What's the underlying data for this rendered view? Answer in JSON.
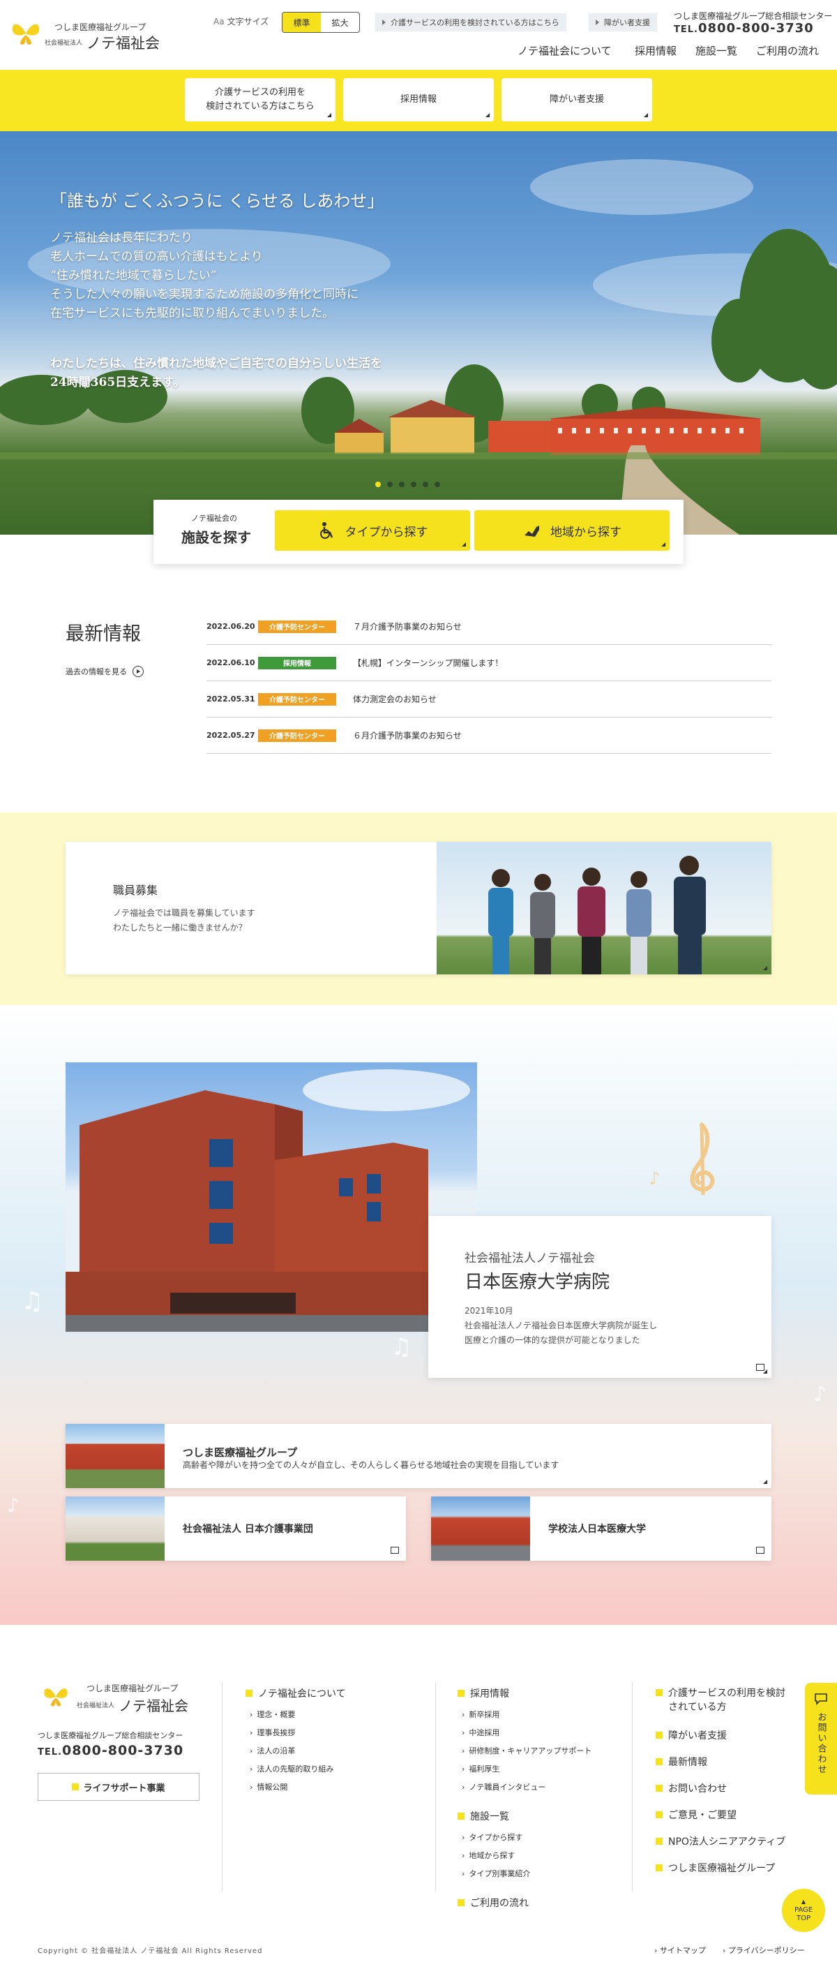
{
  "header": {
    "group_name": "つしま医療福祉グループ",
    "corp_type": "社会福祉法人",
    "org_name": "ノテ福祉会",
    "font_size_label": "文字サイズ",
    "font_size_icon": "Aa",
    "font_size_options": [
      "標準",
      "拡大"
    ],
    "utility_links": [
      "介護サービスの利用を検討されている方はこちら",
      "障がい者支援"
    ],
    "center_label": "つしま医療福祉グループ総合相談センター",
    "tel_prefix": "TEL.",
    "tel": "0800-800-3730",
    "nav": [
      "ノテ福祉会について",
      "採用情報",
      "施設一覧",
      "ご利用の流れ"
    ]
  },
  "band": {
    "buttons": [
      {
        "line1": "介護サービスの利用を",
        "line2": "検討されている方はこちら"
      },
      {
        "line1": "採用情報",
        "line2": ""
      },
      {
        "line1": "障がい者支援",
        "line2": ""
      }
    ]
  },
  "hero": {
    "catch": "「誰もが ごくふつうに くらせる しあわせ」",
    "lead": [
      "ノテ福祉会は長年にわたり",
      "老人ホームでの質の高い介護はもとより",
      "“住み慣れた地域で暮らしたい”",
      "そうした人々の願いを実現するため施設の多角化と同時に",
      "在宅サービスにも先駆的に取り組んでまいりました。"
    ],
    "lead2": [
      "わたしたちは、住み慣れた地域やご自宅での自分らしい生活を",
      "24時間365日支えます。"
    ],
    "slide_count": 6,
    "active_slide": 1
  },
  "search": {
    "title_small": "ノテ福祉会の",
    "title": "施設を探す",
    "by_type": "タイプから探す",
    "by_area": "地域から探す"
  },
  "news": {
    "title": "最新情報",
    "past_link": "過去の情報を見る",
    "items": [
      {
        "date": "2022.06.20",
        "tag": "介護予防センター",
        "tag_color": "#f0a023",
        "text": "７月介護予防事業のお知らせ"
      },
      {
        "date": "2022.06.10",
        "tag": "採用情報",
        "tag_color": "#3f9a3a",
        "text": "【札幌】インターンシップ開催します！"
      },
      {
        "date": "2022.05.31",
        "tag": "介護予防センター",
        "tag_color": "#f0a023",
        "text": "体力測定会のお知らせ"
      },
      {
        "date": "2022.05.27",
        "tag": "介護予防センター",
        "tag_color": "#f0a023",
        "text": "６月介護予防事業のお知らせ"
      }
    ]
  },
  "recruit": {
    "title": "職員募集",
    "line1": "ノテ福祉会では職員を募集しています",
    "line2": "わたしたちと一緒に働きませんか？"
  },
  "hospital": {
    "org": "社会福祉法人ノテ福祉会",
    "name": "日本医療大学病院",
    "date": "2021年10月",
    "desc1": "社会福祉法人ノテ福祉会日本医療大学病院が誕生し",
    "desc2": "医療と介護の一体的な提供が可能となりました"
  },
  "group_cards": {
    "main_title": "つしま医療福祉グループ",
    "main_desc": "高齢者や障がいを持つ全ての人々が自立し、その人らしく暮らせる地域社会の実現を目指しています",
    "card2": "社会福祉法人 日本介護事業団",
    "card3": "学校法人日本医療大学"
  },
  "footer": {
    "group_name": "つしま医療福祉グループ",
    "corp_type": "社会福祉法人",
    "org_name": "ノテ福祉会",
    "center_label": "つしま医療福祉グループ総合相談センター",
    "tel_prefix": "TEL.",
    "tel": "0800-800-3730",
    "life_support": "ライフサポート事業",
    "col1_head": "ノテ福祉会について",
    "col1_links": [
      "理念・概要",
      "理事長挨拶",
      "法人の沿革",
      "法人の先駆的取り組み",
      "情報公開"
    ],
    "col2_head": "採用情報",
    "col2_links": [
      "新卒採用",
      "中途採用",
      "研修制度・キャリアアップサポート",
      "福利厚生",
      "ノテ職員インタビュー"
    ],
    "col2b_head": "施設一覧",
    "col2b_links": [
      "タイプから探す",
      "地域から探す",
      "タイプ別事業紹介"
    ],
    "col2c_head": "ご利用の流れ",
    "col3": [
      "介護サービスの利用を検討",
      "されている方",
      "障がい者支援",
      "最新情報",
      "お問い合わせ",
      "ご意見・ご要望",
      "NPO法人シニアアクティブ",
      "つしま医療福祉グループ"
    ],
    "contact_tab": "お問い合わせ",
    "copyright": "Copyright © 社会福祉法人 ノテ福祉会 All Rights Reserved",
    "sitemap": "サイトマップ",
    "privacy": "プライバシーポリシー",
    "pagetop1": "PAGE",
    "pagetop2": "TOP"
  }
}
